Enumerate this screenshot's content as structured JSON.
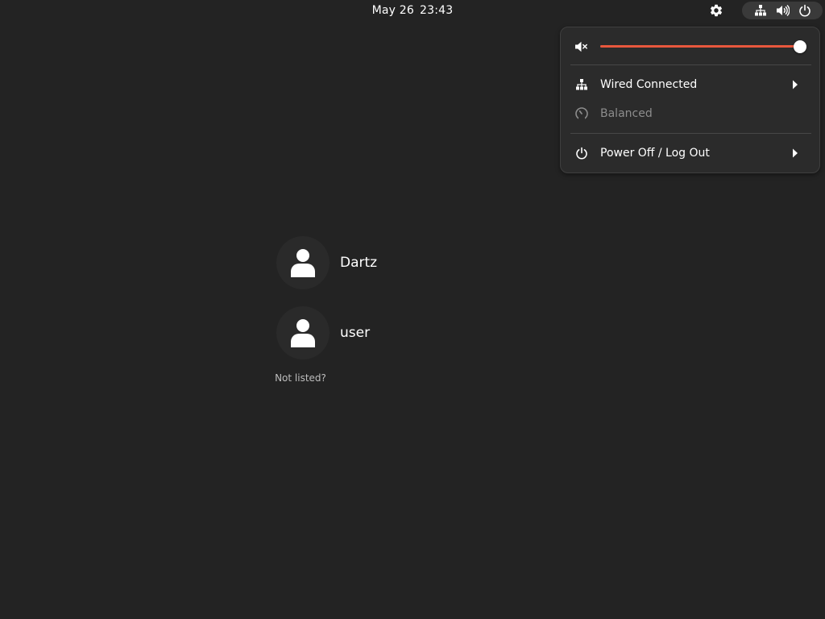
{
  "topbar": {
    "date": "May 26",
    "time": "23:43",
    "accessibility_icon": "gear-icon",
    "status_icons": [
      "network-wired-icon",
      "speaker-icon",
      "power-icon"
    ]
  },
  "quick_menu": {
    "volume": {
      "icon": "speaker-muted-icon",
      "level": 1.0
    },
    "network": {
      "icon": "network-wired-icon",
      "label": "Wired Connected"
    },
    "power_profile": {
      "icon": "power-profile-icon",
      "label": "Balanced",
      "enabled": false
    },
    "power": {
      "icon": "power-icon",
      "label": "Power Off / Log Out"
    }
  },
  "users": [
    {
      "name": "Dartz",
      "icon": "avatar-icon"
    },
    {
      "name": "user",
      "icon": "avatar-icon"
    }
  ],
  "not_listed": "Not listed?",
  "colors": {
    "background": "#232323",
    "accent": "#e8573d",
    "menu_bg": "#2b2b2b"
  }
}
